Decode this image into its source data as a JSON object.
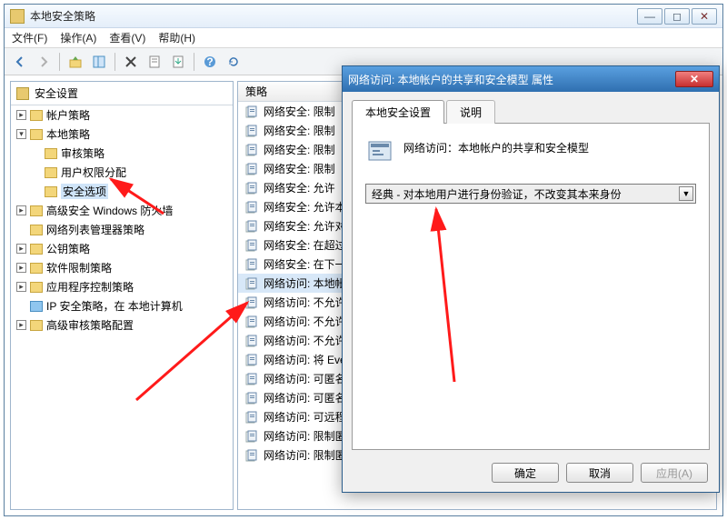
{
  "window": {
    "title": "本地安全策略",
    "menu": {
      "file": "文件(F)",
      "action": "操作(A)",
      "view": "查看(V)",
      "help": "帮助(H)"
    }
  },
  "tree": {
    "root": "安全设置",
    "items": [
      {
        "label": "帐户策略",
        "exp": "▸"
      },
      {
        "label": "本地策略",
        "exp": "▾",
        "children": [
          {
            "label": "审核策略"
          },
          {
            "label": "用户权限分配"
          },
          {
            "label": "安全选项",
            "selected": true
          }
        ]
      },
      {
        "label": "高级安全 Windows 防火墙",
        "exp": "▸"
      },
      {
        "label": "网络列表管理器策略"
      },
      {
        "label": "公钥策略",
        "exp": "▸"
      },
      {
        "label": "软件限制策略",
        "exp": "▸"
      },
      {
        "label": "应用程序控制策略",
        "exp": "▸"
      },
      {
        "label": "IP 安全策略，在 本地计算机",
        "blue": true
      },
      {
        "label": "高级审核策略配置",
        "exp": "▸"
      }
    ]
  },
  "list": {
    "header": "策略",
    "rows": [
      "网络安全: 限制",
      "网络安全: 限制",
      "网络安全: 限制",
      "网络安全: 限制",
      "网络安全: 允许",
      "网络安全: 允许本",
      "网络安全: 允许对",
      "网络安全: 在超过",
      "网络安全: 在下一",
      "网络访问: 本地帐",
      "网络访问: 不允许",
      "网络访问: 不允许",
      "网络访问: 不允许",
      "网络访问: 将 Eve",
      "网络访问: 可匿名",
      "网络访问: 可匿名",
      "网络访问: 可远程",
      "网络访问: 限制匿",
      "网络访问: 限制匿"
    ],
    "selected_index": 9
  },
  "dialog": {
    "title": "网络访问: 本地帐户的共享和安全模型 属性",
    "tabs": {
      "t0": "本地安全设置",
      "t1": "说明"
    },
    "heading": "网络访问：本地帐户的共享和安全模型",
    "combo_value": "经典 - 对本地用户进行身份验证，不改变其本来身份",
    "buttons": {
      "ok": "确定",
      "cancel": "取消",
      "apply": "应用(A)"
    }
  }
}
